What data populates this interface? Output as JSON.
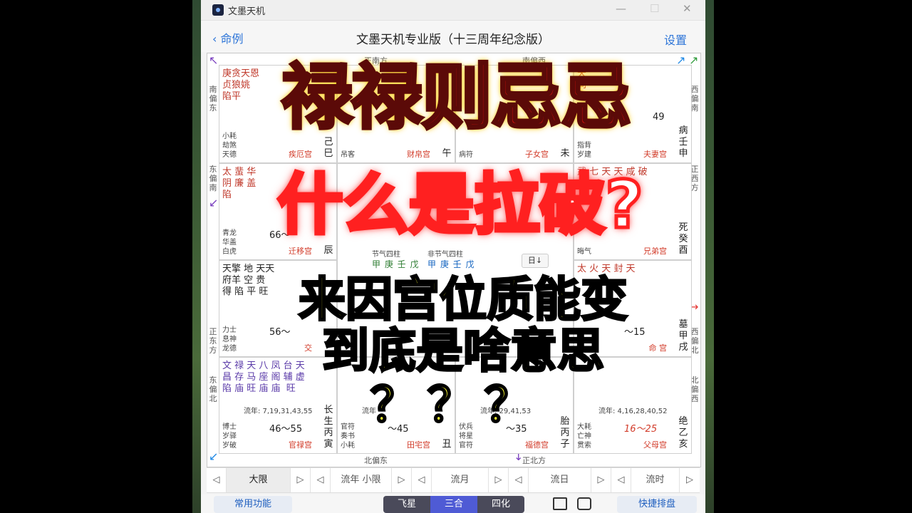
{
  "window": {
    "title": "文墨天机",
    "minimize": "—",
    "maximize": "☐",
    "close": "✕"
  },
  "nav": {
    "back": "‹ 命例",
    "title": "文墨天机专业版（十三周年纪念版）",
    "settings": "设置"
  },
  "directions": {
    "top_center": "正南方",
    "top_right": "南偏西",
    "left_top": "南偏东",
    "left_mid": "东偏南",
    "left_low": "正东方",
    "left_bottom": "东偏北",
    "right_top": "西偏南",
    "right_mid": "正西方",
    "right_low": "西偏北",
    "right_bottom": "北偏西",
    "bottom_center": "北偏东",
    "bottom_right": "正北方"
  },
  "palaces": [
    {
      "stars": "庚贪天恩\n贞狼姚\n陷平",
      "name": "疾厄宫",
      "zhi": "己巳",
      "small": "小耗\n劫煞\n天德",
      "dax": ""
    },
    {
      "stars": "",
      "name": "财帛宫",
      "zhi": "午",
      "small": "吊客",
      "dax": ""
    },
    {
      "stars": "",
      "name": "子女宫",
      "zhi": "未",
      "small": "病符",
      "dax": ""
    },
    {
      "stars": "天\n同\n旺",
      "name": "夫妻宫",
      "zhi": "病壬申",
      "small": "指背\n岁建",
      "dax": "49"
    },
    {
      "stars": "太 蜚 华\n阴 廉 盖\n陷",
      "name": "迁移宫",
      "zhi": "辰",
      "small": "青龙\n华盖\n白虎",
      "dax": "66～"
    },
    {
      "stars": "武 七 天 天 咸 破",
      "name": "兄弟宫",
      "zhi": "死癸酉",
      "small": "晦气",
      "dax": ""
    },
    {
      "stars": "天擎 地 天天\n府羊 空 贵\n得 陷 平 旺",
      "name": "交",
      "zhi": "",
      "small": "力士\n息神\n龙德",
      "dax": "56～"
    },
    {
      "stars": "太 火 天 封 天",
      "name": "命 宫",
      "zhi": "墓甲戌",
      "small": "",
      "dax": "～15"
    },
    {
      "stars": "文 禄 天 八 凤 台 天\n昌 存 马 座 阁 辅 虚\n陷 庙 旺 庙 庙  旺",
      "name": "官禄宫",
      "zhi": "长生丙寅",
      "small": "博士\n岁驿\n岁破",
      "dax": "46～55",
      "liunian": "流年: 7,19,31,43,55"
    },
    {
      "stars": "",
      "name": "田宅宫",
      "zhi": "丑",
      "small": "官符\n奏书\n小耗",
      "dax": "～45",
      "liunian": "流年"
    },
    {
      "stars": "",
      "name": "福德宫",
      "zhi": "胎丙子",
      "small": "伏兵\n将星\n官符",
      "dax": "～35",
      "liunian": "流年: 29,41,53"
    },
    {
      "stars": "",
      "name": "父母宫",
      "zhi": "绝乙亥",
      "small": "大耗\n亡神\n贯索",
      "dax": "16～25",
      "liunian": "流年: 4,16,28,40,52"
    }
  ],
  "center": {
    "line1": "节气四柱",
    "line2": "非节气四柱",
    "gz1": "甲 庚 壬 戊",
    "gz2": "甲 庚 壬 戊",
    "day_btn": "日↓"
  },
  "overlay": {
    "line1": "禄禄则忌忌",
    "line2": "什么是拉破?",
    "line3": "来因宫位质能变",
    "line4": "到底是啥意思",
    "line5": "？？？"
  },
  "tabs": [
    {
      "prev": "◁",
      "label": "大限",
      "next": "▷"
    },
    {
      "prev": "◁",
      "label": "流年 小限",
      "next": "▷"
    },
    {
      "prev": "◁",
      "label": "流月",
      "next": "▷"
    },
    {
      "prev": "◁",
      "label": "流日",
      "next": "▷"
    },
    {
      "prev": "◁",
      "label": "流时",
      "next": "▷"
    }
  ],
  "toolbar": {
    "common": "常用功能",
    "seg1": "飞星",
    "seg2": "三合",
    "seg3": "四化",
    "quick": "快捷排盘"
  },
  "colors": {
    "accent": "#2f76d8",
    "palace_red": "#d23c2a",
    "seg_dark": "#4a4a5a",
    "seg_active": "#4f5bd5"
  }
}
